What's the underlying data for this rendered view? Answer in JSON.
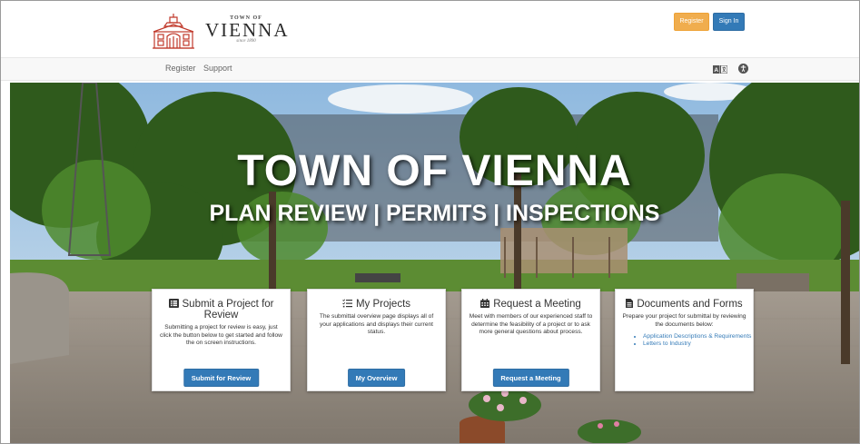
{
  "header": {
    "logo": {
      "small": "TOWN OF",
      "big": "VIENNA",
      "since": "since 1890"
    },
    "register_label": "Register",
    "signin_label": "Sign In"
  },
  "nav": {
    "register": "Register",
    "support": "Support"
  },
  "hero": {
    "title": "TOWN OF VIENNA",
    "subtitle": "PLAN REVIEW | PERMITS | INSPECTIONS"
  },
  "cards": [
    {
      "icon": "list-icon",
      "title": "Submit a Project for Review",
      "desc": "Submitting a project for review is easy, just click the button below to get started and follow the on screen instructions.",
      "button": "Submit for Review"
    },
    {
      "icon": "checklist-icon",
      "title": "My Projects",
      "desc": "The submittal overview page displays all of your applications and displays their current status.",
      "button": "My Overview"
    },
    {
      "icon": "calendar-icon",
      "title": "Request a Meeting",
      "desc": "Meet with members of our experienced staff to determine the feasibility of a project or to ask more general questions about process.",
      "button": "Request a Meeting"
    },
    {
      "icon": "document-icon",
      "title": "Documents and Forms",
      "desc": "Prepare your project for submittal by reviewing the documents below:",
      "links": [
        "Application Descriptions & Requirements",
        "Letters to Industry"
      ]
    }
  ],
  "colors": {
    "primary": "#337ab7",
    "warning": "#f0ad4e"
  }
}
